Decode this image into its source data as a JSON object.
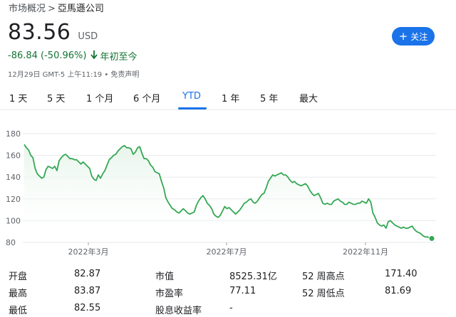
{
  "breadcrumb": {
    "root": "市场概况",
    "sep": ">",
    "current": "亞馬遜公司"
  },
  "quote": {
    "price": "83.56",
    "currency": "USD",
    "change": "-86.84 (-50.96%)",
    "change_period": "年初至今",
    "timestamp": "12月29日 GMT-5 上午11:19 • 免责声明"
  },
  "follow_button": {
    "label": "关注",
    "icon": "plus-icon"
  },
  "tabs": [
    {
      "label": "1 天"
    },
    {
      "label": "5 天"
    },
    {
      "label": "1 个月"
    },
    {
      "label": "6 个月"
    },
    {
      "label": "YTD",
      "active": true
    },
    {
      "label": "1 年"
    },
    {
      "label": "5 年"
    },
    {
      "label": "最大"
    }
  ],
  "stats": {
    "open_label": "开盘",
    "open_value": "82.87",
    "high_label": "最高",
    "high_value": "83.87",
    "low_label": "最低",
    "low_value": "82.55",
    "mcap_label": "市值",
    "mcap_value": "8525.31亿",
    "pe_label": "市盈率",
    "pe_value": "77.11",
    "div_label": "股息收益率",
    "div_value": "-",
    "wk_high_label": "52 周高点",
    "wk_high_value": "171.40",
    "wk_low_label": "52 周低点",
    "wk_low_value": "81.69"
  },
  "colors": {
    "accent": "#1a73e8",
    "positive": "#137333",
    "line": "#34a853"
  },
  "chart_data": {
    "type": "area",
    "yticks": [
      "180",
      "160",
      "140",
      "120",
      "100",
      "80"
    ],
    "ylim": [
      80,
      180
    ],
    "xtick_labels": [
      "2022年3月",
      "2022年7月",
      "2022年11月"
    ],
    "values": [
      170,
      167,
      165,
      160,
      158,
      148,
      143,
      141,
      139,
      140,
      147,
      150,
      149,
      148,
      150,
      146,
      155,
      158,
      160,
      161,
      159,
      157,
      157,
      156,
      156,
      154,
      152,
      154,
      152,
      150,
      148,
      141,
      138,
      137,
      142,
      139,
      143,
      146,
      151,
      156,
      158,
      160,
      161,
      164,
      166,
      168,
      169,
      167,
      167,
      166,
      161,
      163,
      167,
      168,
      162,
      157,
      157,
      155,
      151,
      149,
      145,
      144,
      143,
      136,
      130,
      121,
      117,
      114,
      111,
      110,
      108,
      107,
      109,
      111,
      109,
      107,
      106,
      107,
      108,
      114,
      118,
      121,
      123,
      120,
      116,
      114,
      111,
      106,
      104,
      103,
      105,
      109,
      113,
      111,
      112,
      110,
      108,
      106,
      108,
      110,
      113,
      116,
      117,
      119,
      120,
      117,
      116,
      118,
      121,
      124,
      125,
      130,
      136,
      139,
      142,
      141,
      142,
      143,
      144,
      142,
      142,
      140,
      137,
      135,
      136,
      134,
      133,
      132,
      133,
      134,
      132,
      128,
      125,
      123,
      124,
      125,
      121,
      116,
      115,
      116,
      115,
      115,
      118,
      119,
      120,
      118,
      117,
      115,
      115,
      117,
      116,
      115,
      115,
      116,
      116,
      118,
      117,
      116,
      120,
      117,
      107,
      103,
      98,
      96,
      95,
      96,
      93,
      99,
      100,
      98,
      96,
      95,
      94,
      93,
      94,
      93,
      93,
      94,
      95,
      92,
      90,
      89,
      88,
      86,
      85,
      85,
      84,
      83.56
    ],
    "last_value": 83.56
  }
}
